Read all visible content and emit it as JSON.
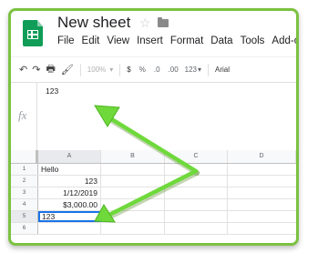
{
  "app": {
    "title": "New sheet",
    "menu": [
      "File",
      "Edit",
      "View",
      "Insert",
      "Format",
      "Data",
      "Tools",
      "Add-ons"
    ]
  },
  "toolbar": {
    "zoom": "100%",
    "currency": "$",
    "percent": "%",
    "dec_decrease": ".0",
    "dec_increase": ".00",
    "more_formats": "123",
    "font": "Arial"
  },
  "formula_bar": {
    "label": "fx",
    "value": "123"
  },
  "sheet": {
    "columns": [
      "A",
      "B",
      "C",
      "D"
    ],
    "rows": [
      {
        "num": "1",
        "a": "Hello",
        "align": "left"
      },
      {
        "num": "2",
        "a": "123",
        "align": "right"
      },
      {
        "num": "3",
        "a": "1/12/2019",
        "align": "right"
      },
      {
        "num": "4",
        "a": "$3,000.00",
        "align": "right"
      },
      {
        "num": "5",
        "a": "123",
        "align": "left",
        "selected": true
      },
      {
        "num": "6",
        "a": "",
        "align": "left"
      }
    ]
  },
  "colors": {
    "frame_green": "#7cc142",
    "sheets_green": "#0f9d58",
    "selection_blue": "#1a73e8",
    "arrow_green": "#6fd93c"
  }
}
